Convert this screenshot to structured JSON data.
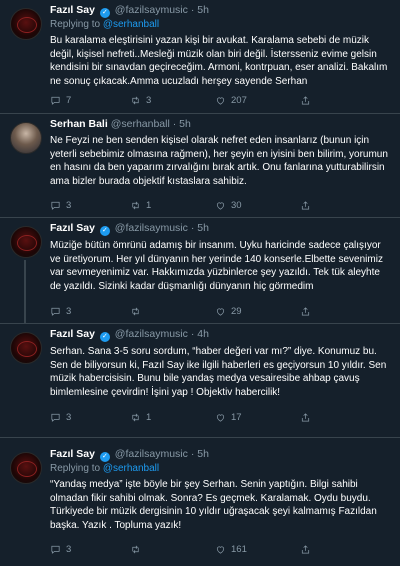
{
  "tweets": [
    {
      "name": "Fazıl Say",
      "handle": "@fazilsaymusic",
      "time": "5h",
      "replying_prefix": "Replying to",
      "replying_to": "@serhanball",
      "text": "Bu karalama eleştirisini yazan kişi bir avukat. Karalama sebebi de müzik değil, kişisel nefreti..Mesleği müzik olan biri değil. İstersseniz evime gelsin kendisini bir sınavdan geçireceğim. Armoni, kontrpuan, eser analizi. Bakalım ne sonuç çıkacak.Amma ucuzladı herşey sayende Serhan",
      "replies": "7",
      "retweets": "3",
      "likes": "207"
    },
    {
      "name": "Serhan Bali",
      "handle": "@serhanball",
      "time": "5h",
      "text": "Ne Feyzi ne ben senden kişisel olarak nefret eden insanlarız (bunun için yeterli sebebimiz olmasına rağmen), her şeyin en iyisini ben bilirim, yorumun en hasını da ben yaparım zırvalığını bırak artık. Onu fanlarına yutturabilirsin ama bizler burada objektif kıstaslara sahibiz.",
      "replies": "3",
      "retweets": "1",
      "likes": "30"
    },
    {
      "name": "Fazıl Say",
      "handle": "@fazilsaymusic",
      "time": "5h",
      "text": "Müziğe bütün ömrünü adamış bir insanım. Uyku haricinde sadece çalışıyor ve üretiyorum. Her yıl dünyanın her yerinde 140 konserle.Elbette sevenimiz var sevmeyenimiz var. Hakkımızda yüzbinlerce şey yazıldı. Tek tük aleyhte de yazıldı. Sizinki kadar düşmanlığı dünyanın hiç görmedim",
      "replies": "3",
      "retweets": "",
      "likes": "29"
    },
    {
      "name": "Fazıl Say",
      "handle": "@fazilsaymusic",
      "time": "4h",
      "text": "Serhan. Sana 3-5 soru sordum, “haber değeri var mı?” diye. Konumuz bu. Sen de biliyorsun ki, Fazıl Say ike ilgili haberleri es geçiyorsun 10 yıldır. Sen müzik habercisisin. Bunu bile yandaş medya vesairesibe ahbap çavuş bimlemlesine çevirdin! İşini yap ! Objektiv habercilik!",
      "replies": "3",
      "retweets": "1",
      "likes": "17"
    },
    {
      "name": "Fazıl Say",
      "handle": "@fazilsaymusic",
      "time": "5h",
      "replying_prefix": "Replying to",
      "replying_to": "@serhanball",
      "text": "“Yandaş medya” işte böyle bir şey Serhan. Senin yaptığın. Bilgi sahibi olmadan fikir sahibi olmak. Sonra? Es geçmek. Karalamak. Oydu buydu. Türkiyede bir müzik dergisinin 10 yıldır uğraşacak şeyi kalmamış Fazıldan başka. Yazık . Topluma yazık!",
      "replies": "3",
      "retweets": "",
      "likes": "161"
    }
  ],
  "icons": {
    "reply": "reply-icon",
    "retweet": "retweet-icon",
    "like": "heart-icon",
    "share": "share-icon"
  },
  "colors": {
    "background": "#15202b",
    "accent": "#1d9bf0",
    "muted": "#8899a6",
    "border": "#38444d"
  }
}
